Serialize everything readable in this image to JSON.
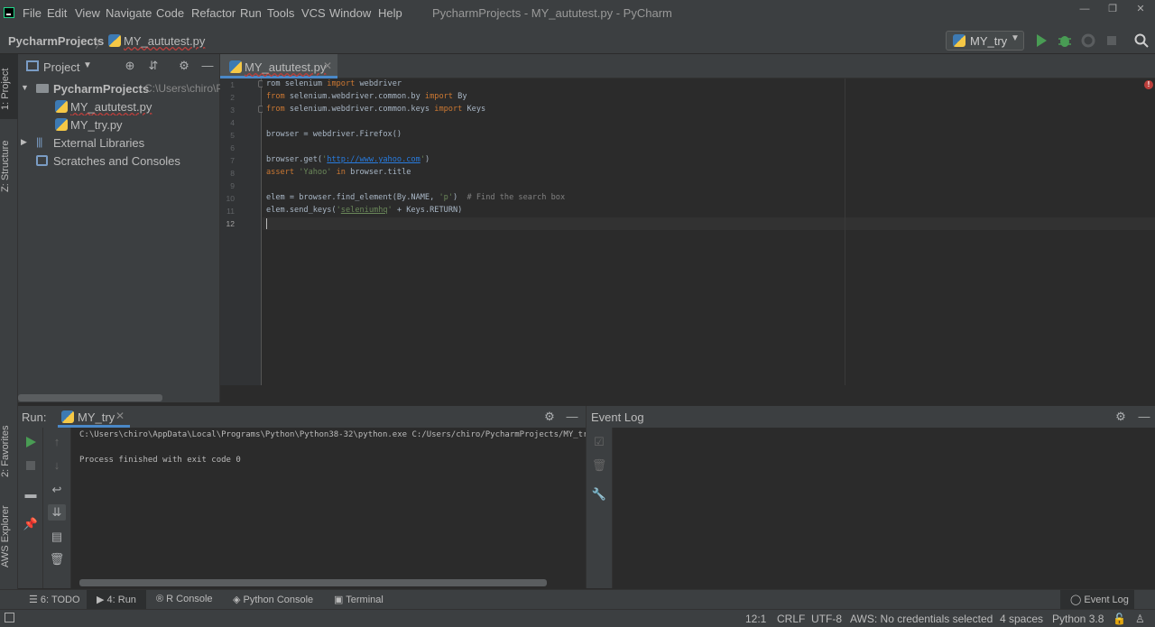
{
  "window": {
    "title": "PycharmProjects - MY_aututest.py - PyCharm",
    "menu": [
      "File",
      "Edit",
      "View",
      "Navigate",
      "Code",
      "Refactor",
      "Run",
      "Tools",
      "VCS",
      "Window",
      "Help"
    ],
    "controls": {
      "minimize": "—",
      "maximize": "❐",
      "close": "✕"
    }
  },
  "navbar": {
    "root": "PycharmProjects",
    "separator": "〉",
    "file": "MY_aututest.py",
    "run_config": "MY_try",
    "run_config_chevron": "▼"
  },
  "left_stripe": {
    "project": "1: Project",
    "structure": "Z: Structure",
    "favorites": "2: Favorites",
    "aws": "AWS Explorer"
  },
  "project_panel": {
    "title": "Project",
    "root_name": "PycharmProjects",
    "root_path": "C:\\Users\\chiro\\P",
    "files": [
      "MY_aututest.py",
      "MY_try.py"
    ],
    "external": "External Libraries",
    "scratches": "Scratches and Consoles"
  },
  "editor": {
    "tab": "MY_aututest.py",
    "tab_close": "✕",
    "line_numbers": [
      "1",
      "2",
      "3",
      "4",
      "5",
      "6",
      "7",
      "8",
      "9",
      "10",
      "11",
      "12"
    ],
    "code": {
      "l1_a": "rom selenium ",
      "l1_b": "import",
      "l1_c": " webdriver",
      "l2_a": "from",
      "l2_b": " selenium.webdriver.common.by ",
      "l2_c": "import",
      "l2_d": " By",
      "l3_a": "from",
      "l3_b": " selenium.webdriver.common.keys ",
      "l3_c": "import",
      "l3_d": " Keys",
      "l5": "browser = webdriver.Firefox()",
      "l7_a": "browser.get(",
      "l7_b": "'",
      "l7_c": "http://www.yahoo.com",
      "l7_d": "'",
      "l7_e": ")",
      "l8_a": "assert",
      "l8_b": " 'Yahoo'",
      "l8_c": " in",
      "l8_d": " browser.title",
      "l10_a": "elem = browser.find_element(By.NAME, ",
      "l10_b": "'p'",
      "l10_c": ")  ",
      "l10_d": "# Find the search box",
      "l11_a": "elem.send_keys(",
      "l11_b": "'",
      "l11_c": "seleniumhq",
      "l11_d": "'",
      "l11_e": " + Keys.RETURN)"
    },
    "error_count": "!"
  },
  "run_panel": {
    "label": "Run:",
    "tab": "MY_try",
    "tab_close": "✕",
    "console": [
      "C:\\Users\\chiro\\AppData\\Local\\Programs\\Python\\Python38-32\\python.exe C:/Users/chiro/PycharmProjects/MY_try",
      "",
      "Process finished with exit code 0"
    ]
  },
  "event_log": {
    "title": "Event Log"
  },
  "bottom_tabs": {
    "todo": "6: TODO",
    "run": "4: Run",
    "r_console": "R Console",
    "python_console": "Python Console",
    "terminal": "Terminal",
    "event_log": "Event Log"
  },
  "status": {
    "position": "12:1",
    "line_sep": "CRLF",
    "encoding": "UTF-8",
    "aws": "AWS: No credentials selected",
    "indent": "4 spaces",
    "interpreter": "Python 3.8"
  },
  "colors": {
    "accent": "#4a88c7",
    "run_green": "#499c54",
    "error": "#bc3f3c",
    "keyword": "#cc7832",
    "string": "#6a8759"
  }
}
